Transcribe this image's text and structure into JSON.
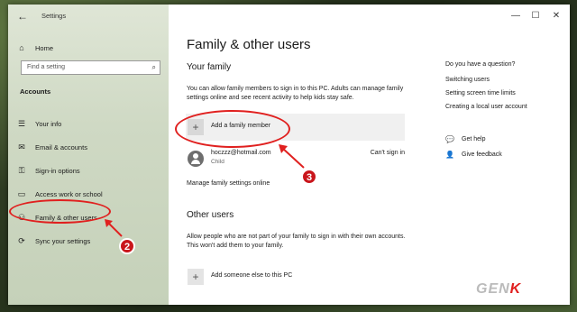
{
  "window": {
    "title": "Settings"
  },
  "sidebar": {
    "home_label": "Home",
    "search_placeholder": "Find a setting",
    "section_heading": "Accounts",
    "items": [
      {
        "label": "Your info",
        "icon": "person-card-icon"
      },
      {
        "label": "Email & accounts",
        "icon": "mail-icon"
      },
      {
        "label": "Sign-in options",
        "icon": "key-icon"
      },
      {
        "label": "Access work or school",
        "icon": "briefcase-icon"
      },
      {
        "label": "Family & other users",
        "icon": "people-icon",
        "selected": true
      },
      {
        "label": "Sync your settings",
        "icon": "sync-icon"
      }
    ]
  },
  "main": {
    "title": "Family & other users",
    "your_family": {
      "heading": "Your family",
      "description": "You can allow family members to sign in to this PC. Adults can manage family settings online and see recent activity to help kids stay safe.",
      "add_label": "Add a family member",
      "member": {
        "email": "hoczzz@hotmail.com",
        "role": "Child",
        "status": "Can't sign in"
      },
      "manage_link": "Manage family settings online"
    },
    "other_users": {
      "heading": "Other users",
      "description": "Allow people who are not part of your family to sign in with their own accounts. This won't add them to your family.",
      "add_label": "Add someone else to this PC"
    }
  },
  "right_panel": {
    "question": "Do you have a question?",
    "links": [
      "Switching users",
      "Setting screen time limits",
      "Creating a local user account"
    ],
    "get_help": "Get help",
    "give_feedback": "Give feedback"
  },
  "annotations": {
    "badge_2": "2",
    "badge_3": "3",
    "accent_color": "#e0201f"
  },
  "watermark": {
    "prefix": "GEN",
    "suffix": "K"
  }
}
